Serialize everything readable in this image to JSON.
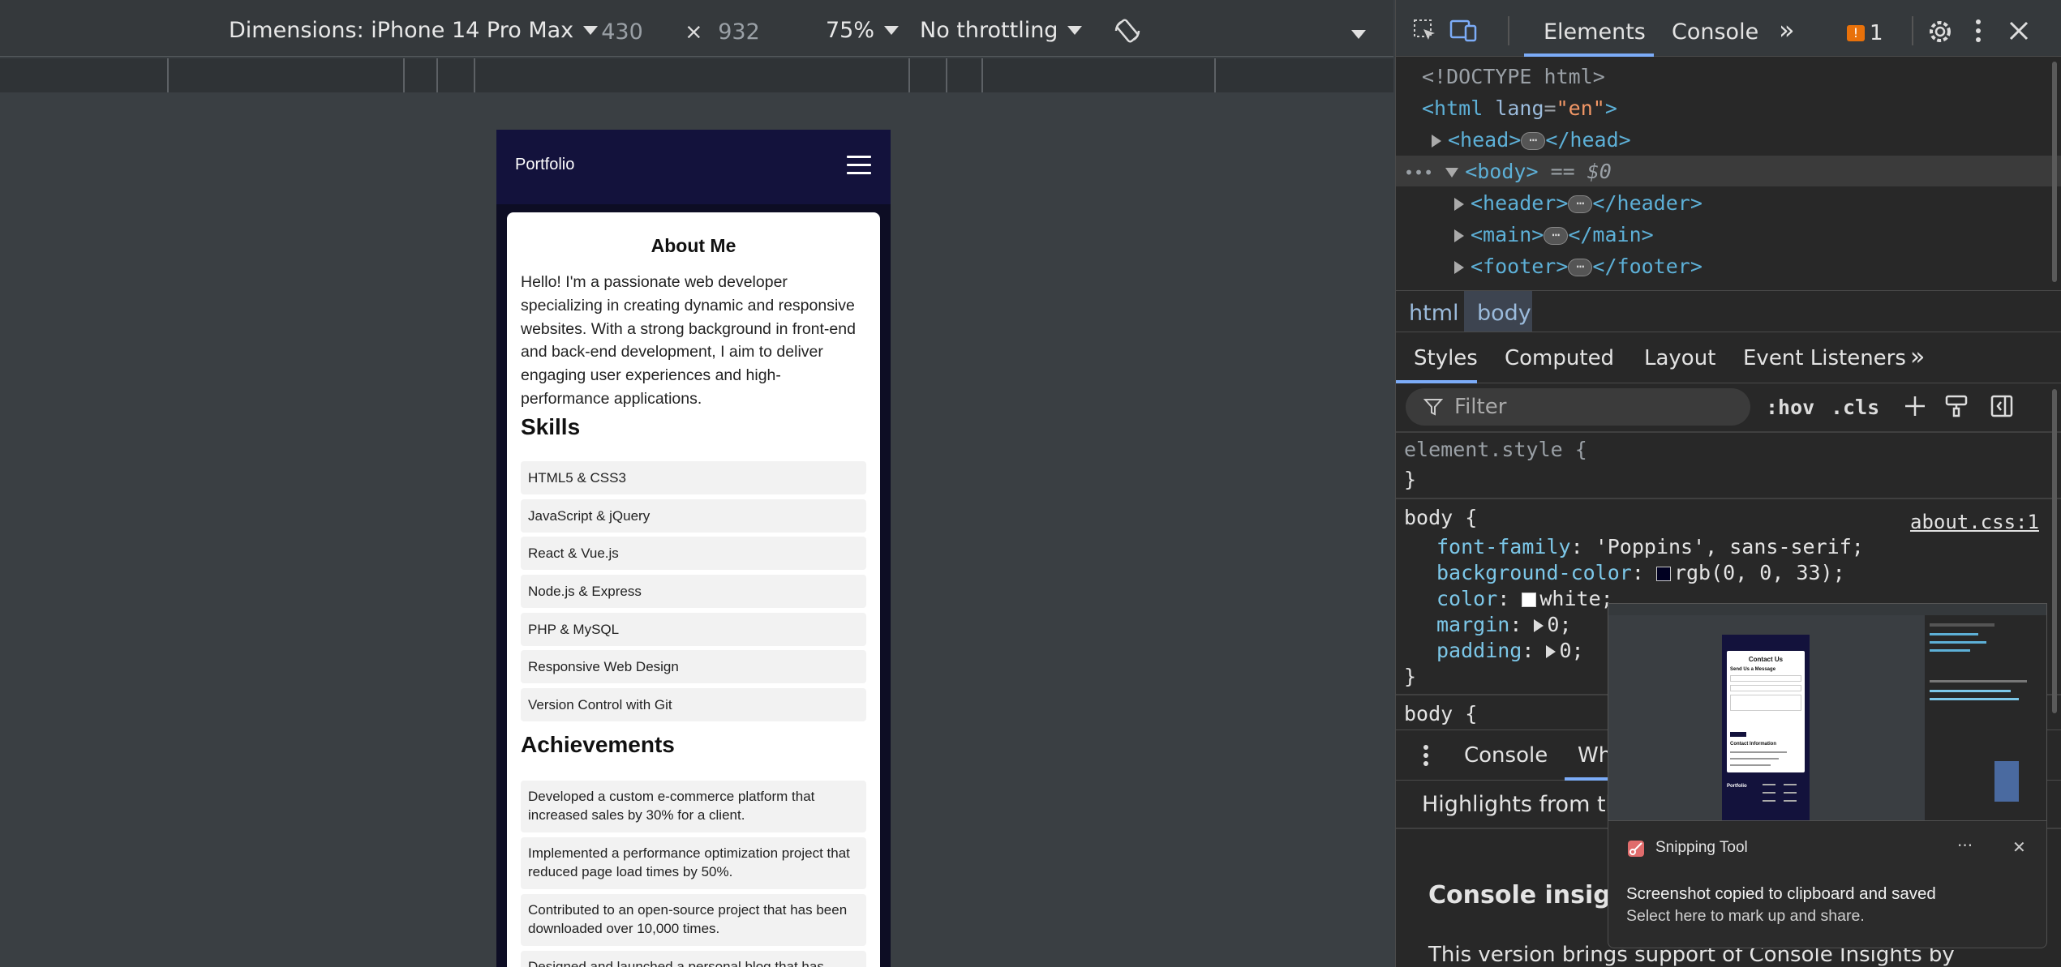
{
  "device_toolbar": {
    "dimensions_label": "Dimensions: iPhone 14 Pro Max",
    "width": "430",
    "times": "×",
    "height": "932",
    "zoom": "75%",
    "throttling": "No throttling"
  },
  "phone": {
    "brand": "Portfolio",
    "about_title": "About Me",
    "about_text": "Hello! I'm a passionate web developer specializing in creating dynamic and responsive websites. With a strong background in front-end and back-end development, I aim to deliver engaging user experiences and high-performance applications.",
    "skills_title": "Skills",
    "skills": [
      "HTML5 & CSS3",
      "JavaScript & jQuery",
      "React & Vue.js",
      "Node.js & Express",
      "PHP & MySQL",
      "Responsive Web Design",
      "Version Control with Git"
    ],
    "achievements_title": "Achievements",
    "achievements": [
      "Developed a custom e-commerce platform that increased sales by 30% for a client.",
      "Implemented a performance optimization project that reduced page load times by 50%.",
      "Contributed to an open-source project that has been downloaded over 10,000 times.",
      "Designed and launched a personal blog that has"
    ]
  },
  "devtools": {
    "tabs": [
      "Elements",
      "Console"
    ],
    "more": "»",
    "issues_count": "1",
    "tree": {
      "doctype": "<!DOCTYPE html>",
      "html_open": "<html",
      "lang_attr": "lang",
      "lang_val": "\"en\"",
      "head": "<head>",
      "head_close": "</head>",
      "body": "<body>",
      "body_eq": "== $0",
      "header": "<header>",
      "header_close": "</header>",
      "main": "<main>",
      "main_close": "</main>",
      "footer": "<footer>",
      "footer_close": "</footer>",
      "ellipsis": "⋯"
    },
    "breadcrumbs": [
      "html",
      "body"
    ],
    "subtabs": [
      "Styles",
      "Computed",
      "Layout",
      "Event Listeners"
    ],
    "filter_placeholder": "Filter",
    "hov": ":hov",
    "cls": ".cls",
    "styles": {
      "element_style": "element.style {",
      "close_brace": "}",
      "body_sel": "body {",
      "source": "about.css:1",
      "props": [
        {
          "name": "font-family",
          "value": "'Poppins', sans-serif;"
        },
        {
          "name": "background-color",
          "value": "rgb(0, 0, 33);",
          "swatch": "#000021"
        },
        {
          "name": "color",
          "value": "white;",
          "swatch": "#ffffff"
        },
        {
          "name": "margin",
          "value": "0;"
        },
        {
          "name": "padding",
          "value": "0;"
        }
      ],
      "body_sel2": "body {"
    },
    "drawer": {
      "tabs": [
        "Console",
        "Wh"
      ],
      "highlights": "Highlights from the",
      "insights_title": "Console insight",
      "insights_text": "This version brings support of Console Insights by"
    }
  },
  "snipping_tool": {
    "app_name": "Snipping Tool",
    "more": "···",
    "close": "✕",
    "title": "Screenshot copied to clipboard and saved",
    "subtitle": "Select here to mark up and share.",
    "preview": {
      "contact_title": "Contact Us",
      "send_message": "Send Us a Message",
      "contact_info": "Contact Information",
      "footer_brand": "Portfolio"
    }
  },
  "colors": {
    "phone_bg": "#0d0d24",
    "phone_header": "#13123c",
    "devtools_bg": "#282828",
    "accent_blue": "#7cacf8",
    "issue_orange": "#e8710a"
  }
}
